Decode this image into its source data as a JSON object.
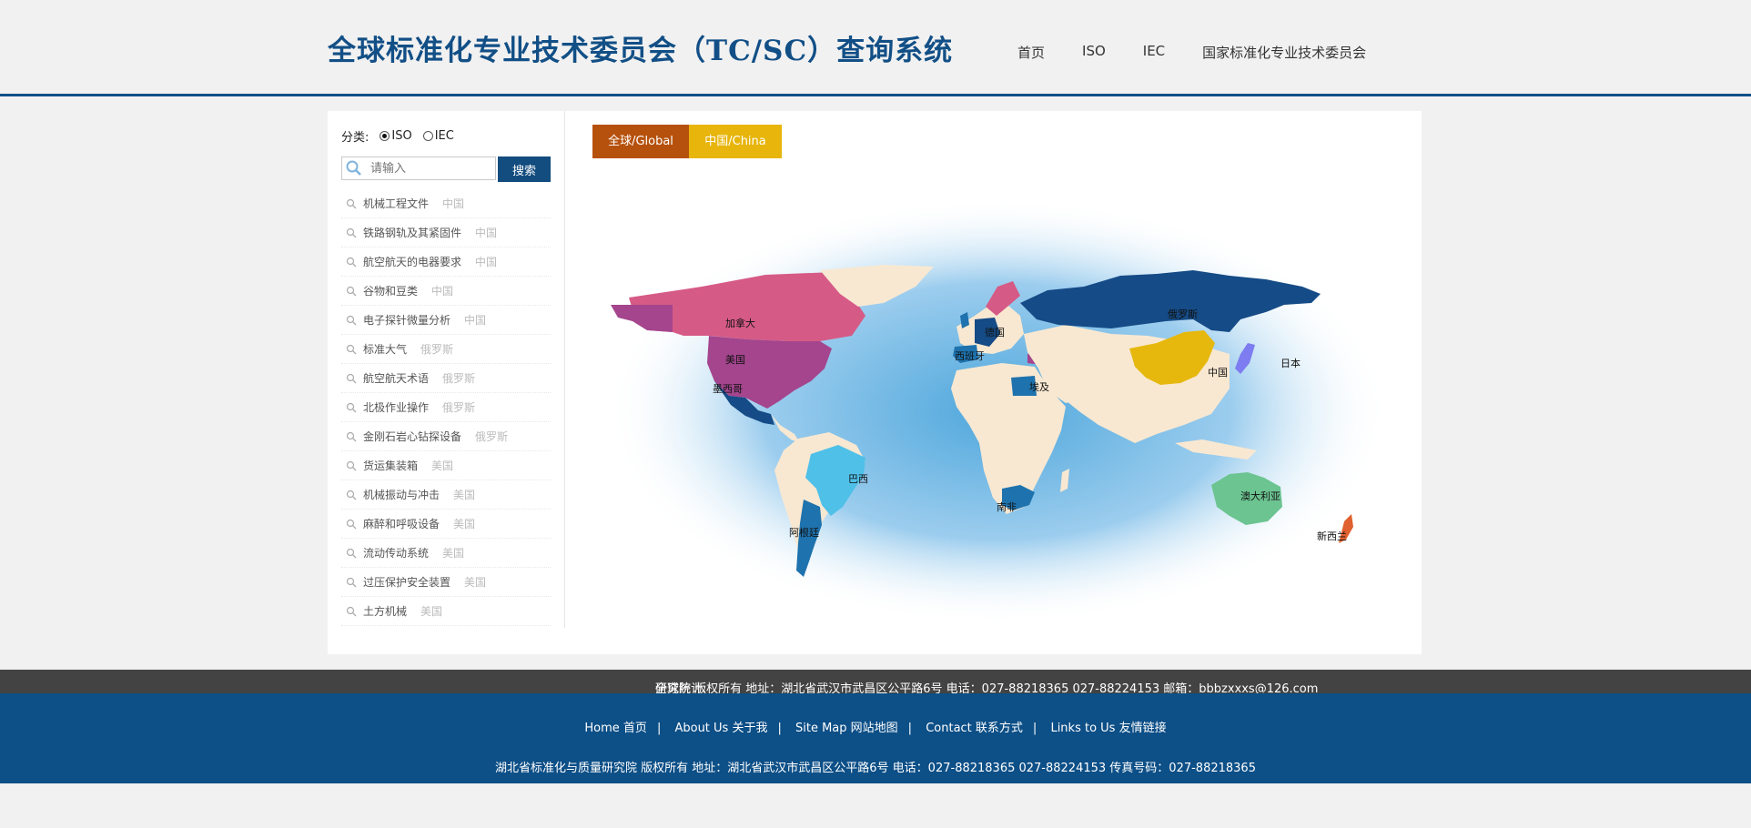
{
  "header": {
    "title": "全球标准化专业技术委员会（TC/SC）查询系统",
    "nav": [
      "首页",
      "ISO",
      "IEC",
      "国家标准化专业技术委员会"
    ]
  },
  "sidebar": {
    "category_label": "分类:",
    "options": [
      "ISO",
      "IEC"
    ],
    "selected": "ISO",
    "search_placeholder": "请输入",
    "search_button": "搜索",
    "items": [
      {
        "name": "机械工程文件",
        "country": "中国"
      },
      {
        "name": "铁路钢轨及其紧固件",
        "country": "中国"
      },
      {
        "name": "航空航天的电器要求",
        "country": "中国"
      },
      {
        "name": "谷物和豆类",
        "country": "中国"
      },
      {
        "name": "电子探针微量分析",
        "country": "中国"
      },
      {
        "name": "标准大气",
        "country": "俄罗斯"
      },
      {
        "name": "航空航天术语",
        "country": "俄罗斯"
      },
      {
        "name": "北极作业操作",
        "country": "俄罗斯"
      },
      {
        "name": "金刚石岩心钻探设备",
        "country": "俄罗斯"
      },
      {
        "name": "货运集装箱",
        "country": "美国"
      },
      {
        "name": "机械振动与冲击",
        "country": "美国"
      },
      {
        "name": "麻醉和呼吸设备",
        "country": "美国"
      },
      {
        "name": "流动传动系统",
        "country": "美国"
      },
      {
        "name": "过压保护安全装置",
        "country": "美国"
      },
      {
        "name": "土方机械",
        "country": "美国"
      }
    ]
  },
  "map": {
    "tabs": [
      "全球/Global",
      "中国/China"
    ],
    "country_labels": [
      "加拿大",
      "美国",
      "墨西哥",
      "巴西",
      "阿根廷",
      "德国",
      "西班牙",
      "埃及",
      "南非",
      "俄罗斯",
      "中国",
      "日本",
      "澳大利亚",
      "新西兰"
    ],
    "colors": {
      "land": "#f8e8d2",
      "ocean_glow": "#8ec7ea",
      "canada": "#d65a86",
      "usa": "#a4458e",
      "russia": "#154b86",
      "china": "#e6b80e",
      "brazil": "#4fc0e8",
      "argentina": "#1e72ad",
      "australia": "#6cc491",
      "tab_global": "#b6510d",
      "tab_china": "#e7b50c"
    }
  },
  "stats_bar": {
    "label": "全球统计:",
    "text": "研究院 版权所有 地址：湖北省武汉市武昌区公平路6号 电话：027-88218365 027-88224153 邮箱：bbbzxxxs@126.com"
  },
  "footer": {
    "links": [
      "Home 首页",
      "About Us 关于我",
      "Site Map 网站地图",
      "Contact 联系方式",
      "Links to Us 友情链接"
    ],
    "copyright": "湖北省标准化与质量研究院 版权所有 地址：湖北省武汉市武昌区公平路6号 电话：027-88218365 027-88224153 传真号码：027-88218365"
  }
}
